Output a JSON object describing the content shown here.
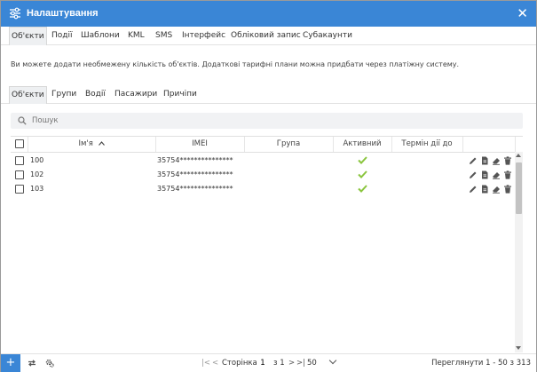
{
  "window": {
    "title": "Налаштування",
    "title_color": "#3a86d6"
  },
  "main_tabs": [
    {
      "label": "Об'єкти"
    },
    {
      "label": "Події"
    },
    {
      "label": "Шаблони"
    },
    {
      "label": "KML"
    },
    {
      "label": "SMS"
    },
    {
      "label": "Інтерфейс"
    },
    {
      "label": "Обліковий запис"
    },
    {
      "label": "Субакаунти"
    }
  ],
  "info_text": "Ви можете додати необмежену кількість об'єктів. Додаткові тарифні плани можна придбати через платіжну систему.",
  "sub_tabs": [
    {
      "label": "Об'єкти"
    },
    {
      "label": "Групи"
    },
    {
      "label": "Водії"
    },
    {
      "label": "Пасажири"
    },
    {
      "label": "Причіпи"
    }
  ],
  "search": {
    "placeholder": "Пошук"
  },
  "table": {
    "columns": {
      "name": "Ім'я",
      "imei": "IMEI",
      "group": "Група",
      "active": "Активний",
      "expiry": "Термін дії до"
    },
    "rows": [
      {
        "name": "100",
        "imei": "35754***************",
        "group": "",
        "active": true,
        "expiry": ""
      },
      {
        "name": "102",
        "imei": "35754***************",
        "group": "",
        "active": true,
        "expiry": ""
      },
      {
        "name": "103",
        "imei": "35754***************",
        "group": "",
        "active": true,
        "expiry": ""
      }
    ],
    "active_color": "#8ac53e"
  },
  "footer": {
    "page_label": "Сторінка",
    "page_value": "1",
    "of_label": "з 1",
    "page_size": "50",
    "viewing": "Переглянути 1 - 50 з 313"
  }
}
